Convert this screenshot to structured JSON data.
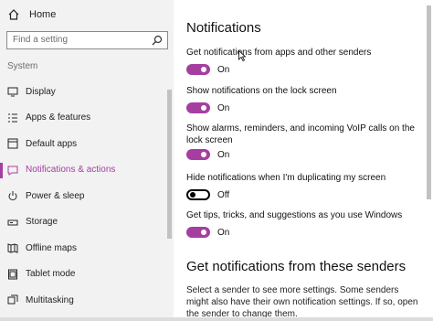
{
  "sidebar": {
    "home_label": "Home",
    "search_placeholder": "Find a setting",
    "section_label": "System",
    "items": [
      {
        "label": "Display",
        "icon": "monitor-icon"
      },
      {
        "label": "Apps & features",
        "icon": "list-icon"
      },
      {
        "label": "Default apps",
        "icon": "default-apps-icon"
      },
      {
        "label": "Notifications & actions",
        "icon": "chat-icon"
      },
      {
        "label": "Power & sleep",
        "icon": "power-icon"
      },
      {
        "label": "Storage",
        "icon": "storage-icon"
      },
      {
        "label": "Offline maps",
        "icon": "map-icon"
      },
      {
        "label": "Tablet mode",
        "icon": "tablet-icon"
      },
      {
        "label": "Multitasking",
        "icon": "multitask-icon"
      }
    ],
    "active_index": 3
  },
  "main": {
    "title": "Notifications",
    "settings": [
      {
        "label": "Get notifications from apps and other senders",
        "state": "On"
      },
      {
        "label": "Show notifications on the lock screen",
        "state": "On"
      },
      {
        "label": "Show alarms, reminders, and incoming VoIP calls on the lock screen",
        "state": "On"
      },
      {
        "label": "Hide notifications when I'm duplicating my screen",
        "state": "Off"
      },
      {
        "label": "Get tips, tricks, and suggestions as you use Windows",
        "state": "On"
      }
    ],
    "senders_title": "Get notifications from these senders",
    "senders_desc": "Select a sender to see more settings. Some senders might also have their own notification settings. If so, open the sender to change them."
  },
  "colors": {
    "accent": "#a63ea0",
    "sidebar_bg": "#f2f2f2"
  }
}
